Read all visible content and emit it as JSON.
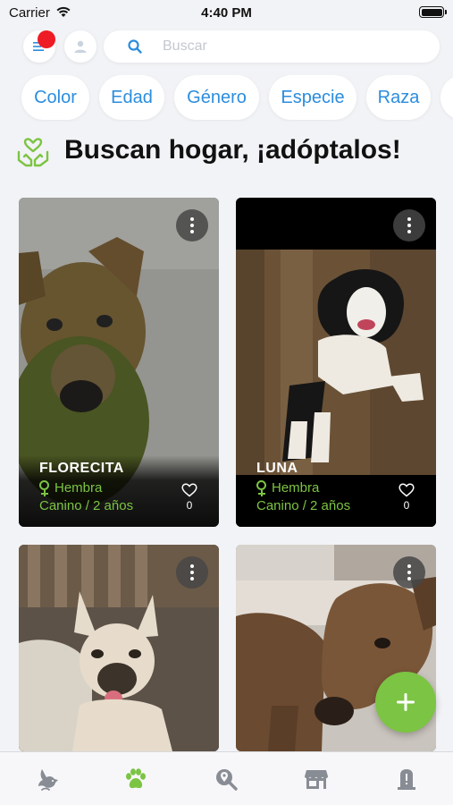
{
  "status_bar": {
    "carrier": "Carrier",
    "time": "4:40 PM"
  },
  "search": {
    "placeholder": "Buscar"
  },
  "filters": [
    {
      "label": "Color"
    },
    {
      "label": "Edad"
    },
    {
      "label": "Género"
    },
    {
      "label": "Especie"
    },
    {
      "label": "Raza"
    }
  ],
  "section": {
    "title": "Buscan hogar, ¡adóptalos!",
    "icon": "heart-hands-icon"
  },
  "pets": [
    {
      "name": "FLORECITA",
      "sex": "Hembra",
      "species_age": "Canino / 2 años",
      "likes": "0"
    },
    {
      "name": "LUNA",
      "sex": "Hembra",
      "species_age": "Canino / 2 años",
      "likes": "0"
    }
  ],
  "tabs": [
    {
      "icon": "dove-icon",
      "active": false
    },
    {
      "icon": "paw-icon",
      "active": true
    },
    {
      "icon": "search-location-icon",
      "active": false
    },
    {
      "icon": "store-icon",
      "active": false
    },
    {
      "icon": "memorial-icon",
      "active": false
    }
  ],
  "colors": {
    "accent_green": "#7cc443",
    "accent_blue": "#2b8dde",
    "badge_red": "#ee1c25",
    "tab_gray": "#888c94"
  }
}
